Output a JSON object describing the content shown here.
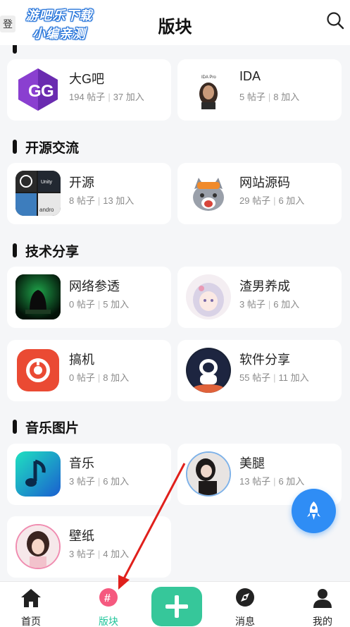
{
  "header": {
    "title": "版块",
    "back_tag": "登"
  },
  "watermark": {
    "line1": "游吧乐下载",
    "line2": "小编亲测"
  },
  "sections": [
    {
      "label": "开源交流"
    },
    {
      "label": "技术分享"
    },
    {
      "label": "音乐图片"
    }
  ],
  "boards": [
    {
      "name": "大G吧",
      "posts": "194 帖子",
      "joins": "37 加入"
    },
    {
      "name": "IDA",
      "posts": "5 帖子",
      "joins": "8 加入"
    },
    {
      "name": "开源",
      "posts": "8 帖子",
      "joins": "13 加入"
    },
    {
      "name": "网站源码",
      "posts": "29 帖子",
      "joins": "6 加入"
    },
    {
      "name": "网络参透",
      "posts": "0 帖子",
      "joins": "5 加入"
    },
    {
      "name": "渣男养成",
      "posts": "3 帖子",
      "joins": "6 加入"
    },
    {
      "name": "搞机",
      "posts": "0 帖子",
      "joins": "8 加入"
    },
    {
      "name": "软件分享",
      "posts": "55 帖子",
      "joins": "11 加入"
    },
    {
      "name": "音乐",
      "posts": "3 帖子",
      "joins": "6 加入"
    },
    {
      "name": "美腿",
      "posts": "13 帖子",
      "joins": "6 加入"
    },
    {
      "name": "壁纸",
      "posts": "3 帖子",
      "joins": "4 加入"
    }
  ],
  "avatars": {
    "ida_caption": "IDA Pro",
    "kaiyuan_caption": "Unity",
    "kaiyuan_caption2": "andro"
  },
  "nav": [
    {
      "label": "首页"
    },
    {
      "label": "版块"
    },
    {
      "label": "消息"
    },
    {
      "label": "我的"
    }
  ],
  "colors": {
    "accent": "#36c79a",
    "active_label": "#1fc59a",
    "fab": "#2f8df5",
    "arrow": "#e0201c"
  }
}
